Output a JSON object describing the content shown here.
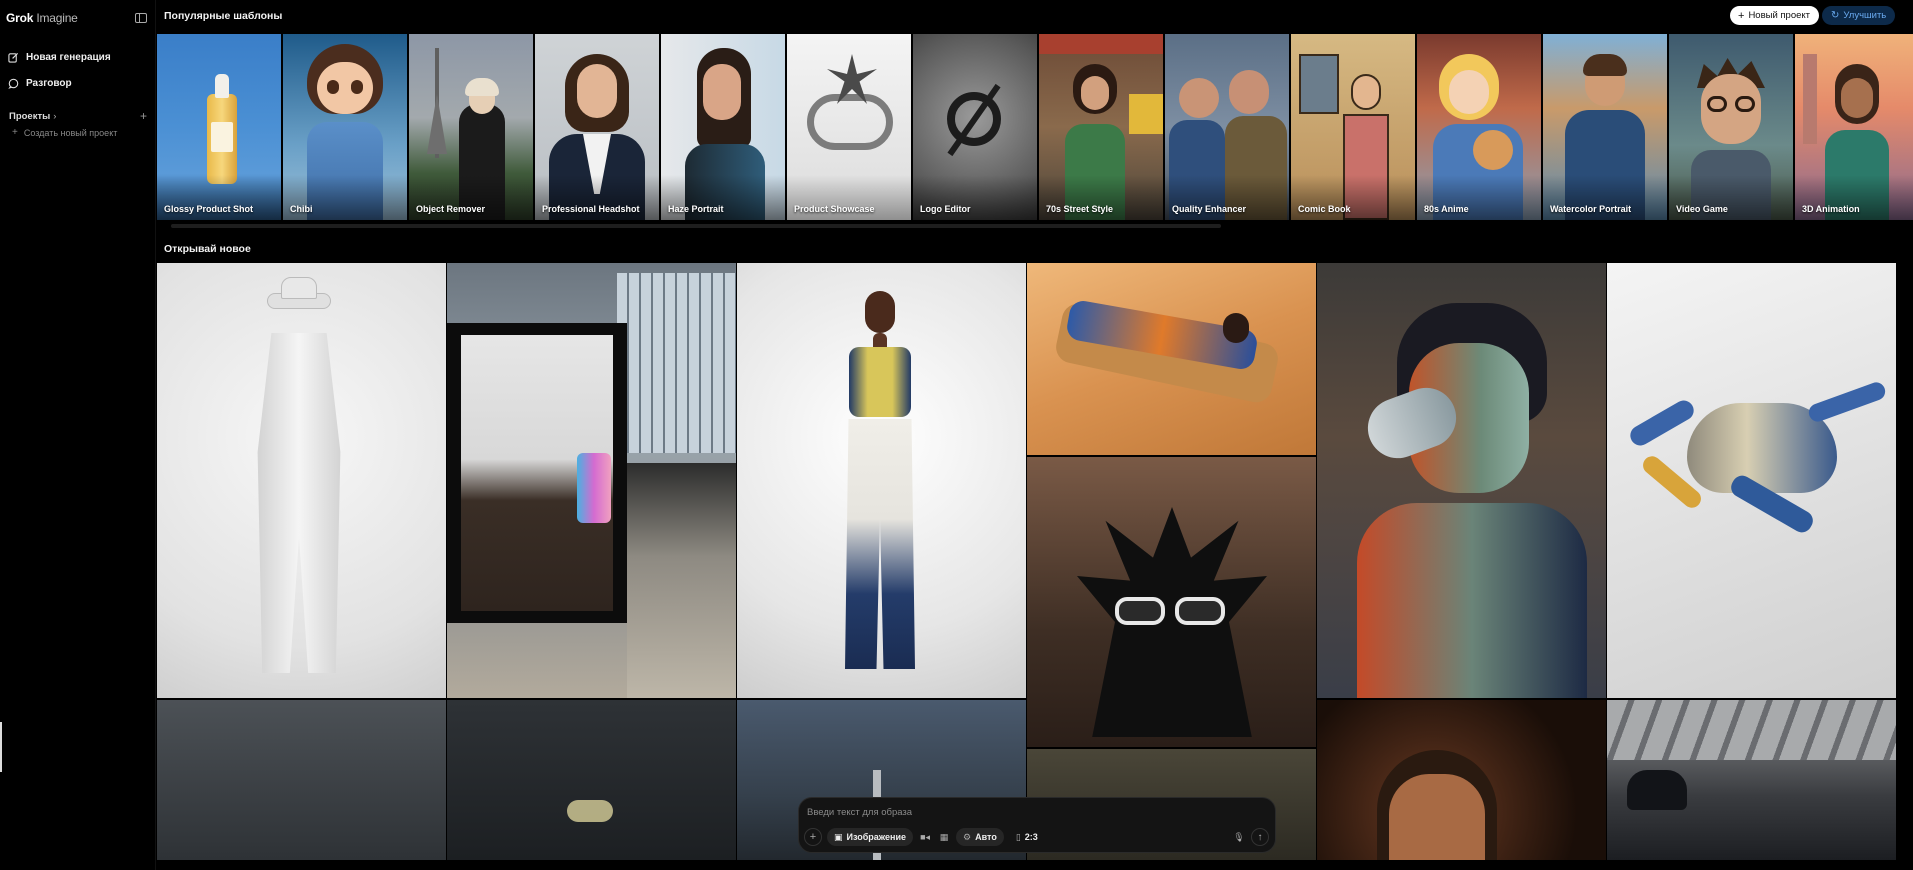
{
  "app": {
    "brand_bold": "Grok",
    "brand_thin": " Imagine"
  },
  "sidebar": {
    "items": [
      {
        "label": "Новая генерация",
        "icon": "edit-icon"
      },
      {
        "label": "Разговор",
        "icon": "chat-icon"
      }
    ],
    "projects_label": "Проекты",
    "create_project_label": "Создать новый проект"
  },
  "header": {
    "popular_title": "Популярные шаблоны",
    "new_project_label": "Новый проект",
    "upgrade_label": "Улучшить"
  },
  "templates": [
    {
      "label": "Glossy Product Shot"
    },
    {
      "label": "Chibi"
    },
    {
      "label": "Object Remover"
    },
    {
      "label": "Professional Headshot"
    },
    {
      "label": "Haze Portrait"
    },
    {
      "label": "Product Showcase"
    },
    {
      "label": "Logo Editor"
    },
    {
      "label": "70s Street Style"
    },
    {
      "label": "Quality Enhancer"
    },
    {
      "label": "Comic Book"
    },
    {
      "label": "80s Anime"
    },
    {
      "label": "Watercolor Portrait"
    },
    {
      "label": "Video Game"
    },
    {
      "label": "3D Animation"
    }
  ],
  "discover": {
    "title": "Открывай новое"
  },
  "prompt": {
    "placeholder": "Введи текст для образа",
    "mode_label": "Изображение",
    "model_label": "Авто",
    "ratio_label": "2:3"
  },
  "colors": {
    "accent": "#6aaaf0",
    "upgrade_bg": "#0d2a4a",
    "background": "#000000"
  }
}
